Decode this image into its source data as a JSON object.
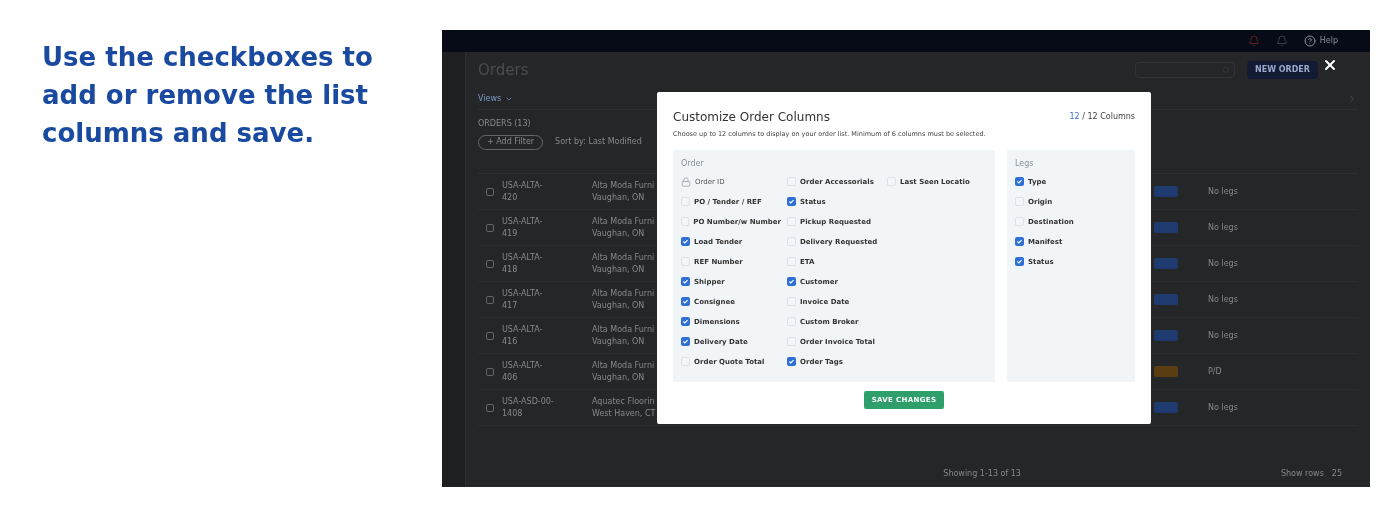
{
  "caption": "Use the checkboxes to add or remove the list columns and save.",
  "app": {
    "help": "Help",
    "title": "Orders",
    "new_order": "NEW ORDER",
    "views": "Views",
    "orders_count": "ORDERS (13)",
    "add_filter": "+ Add Filter",
    "sort": "Sort by: Last Modified",
    "rows": [
      {
        "id": "USA-ALTA-",
        "num": "420",
        "checked": false,
        "shipper": "Alta Moda Furni",
        "city": "Vaughan, ON",
        "color": "#1e3a6e",
        "legs": "No legs"
      },
      {
        "id": "USA-ALTA-",
        "num": "419",
        "checked": false,
        "shipper": "Alta Moda Furni",
        "city": "Vaughan, ON",
        "color": "#1e3a6e",
        "legs": "No legs"
      },
      {
        "id": "USA-ALTA-",
        "num": "418",
        "checked": false,
        "shipper": "Alta Moda Furni",
        "city": "Vaughan, ON",
        "color": "#1e3a6e",
        "legs": "No legs"
      },
      {
        "id": "USA-ALTA-",
        "num": "417",
        "checked": false,
        "shipper": "Alta Moda Furni",
        "city": "Vaughan, ON",
        "color": "#1e3a6e",
        "legs": "No legs"
      },
      {
        "id": "USA-ALTA-",
        "num": "416",
        "checked": false,
        "shipper": "Alta Moda Furni",
        "city": "Vaughan, ON",
        "color": "#1e3a6e",
        "legs": "No legs"
      },
      {
        "id": "USA-ALTA-",
        "num": "406",
        "checked": false,
        "shipper": "Alta Moda Furni",
        "city": "Vaughan, ON",
        "color": "#5a3d10",
        "legs": "P/D"
      },
      {
        "id": "USA-ASD-00-",
        "num": "1408",
        "checked": false,
        "shipper": "Aquatec Floorin",
        "city": "West Haven, CT",
        "color": "#1e3a6e",
        "legs": "No legs"
      }
    ],
    "footer": "Showing 1-13 of 13",
    "show_rows": "Show rows",
    "per_page": "25"
  },
  "modal": {
    "title": "Customize Order Columns",
    "count": "12",
    "count_total": "/ 12 Columns",
    "subtitle": "Choose up to 12 columns to display on your order list. Minimum of 6 columns must be selected.",
    "order": {
      "heading": "Order",
      "columns": [
        [
          {
            "label": "Order ID",
            "kind": "locked"
          },
          {
            "label": "PO / Tender / REF",
            "kind": "checkbox",
            "checked": false
          },
          {
            "label": "PO Number/w Number",
            "kind": "checkbox",
            "checked": false
          },
          {
            "label": "Load Tender",
            "kind": "checkbox",
            "checked": true
          },
          {
            "label": "REF Number",
            "kind": "checkbox",
            "checked": false
          },
          {
            "label": "Shipper",
            "kind": "checkbox",
            "checked": true
          },
          {
            "label": "Consignee",
            "kind": "checkbox",
            "checked": true
          },
          {
            "label": "Dimensions",
            "kind": "checkbox",
            "checked": true
          },
          {
            "label": "Delivery Date",
            "kind": "checkbox",
            "checked": true
          },
          {
            "label": "Order Quote Total",
            "kind": "checkbox",
            "checked": false
          }
        ],
        [
          {
            "label": "Order Accessorials",
            "kind": "checkbox",
            "checked": false
          },
          {
            "label": "Status",
            "kind": "checkbox",
            "checked": true
          },
          {
            "label": "Pickup Requested",
            "kind": "checkbox",
            "checked": false
          },
          {
            "label": "Delivery Requested",
            "kind": "checkbox",
            "checked": false
          },
          {
            "label": "ETA",
            "kind": "checkbox",
            "checked": false
          },
          {
            "label": "Customer",
            "kind": "checkbox",
            "checked": true
          },
          {
            "label": "Invoice Date",
            "kind": "checkbox",
            "checked": false
          },
          {
            "label": "Custom Broker",
            "kind": "checkbox",
            "checked": false
          },
          {
            "label": "Order Invoice Total",
            "kind": "checkbox",
            "checked": false
          },
          {
            "label": "Order Tags",
            "kind": "checkbox",
            "checked": true
          }
        ],
        [
          {
            "label": "Last Seen Locatio",
            "kind": "checkbox",
            "checked": false
          }
        ]
      ]
    },
    "legs": {
      "heading": "Legs",
      "items": [
        {
          "label": "Type",
          "kind": "checkbox",
          "checked": true
        },
        {
          "label": "Origin",
          "kind": "checkbox",
          "checked": false
        },
        {
          "label": "Destination",
          "kind": "checkbox",
          "checked": false
        },
        {
          "label": "Manifest",
          "kind": "checkbox",
          "checked": true
        },
        {
          "label": "Status",
          "kind": "checkbox",
          "checked": true
        }
      ]
    },
    "save": "SAVE CHANGES"
  }
}
